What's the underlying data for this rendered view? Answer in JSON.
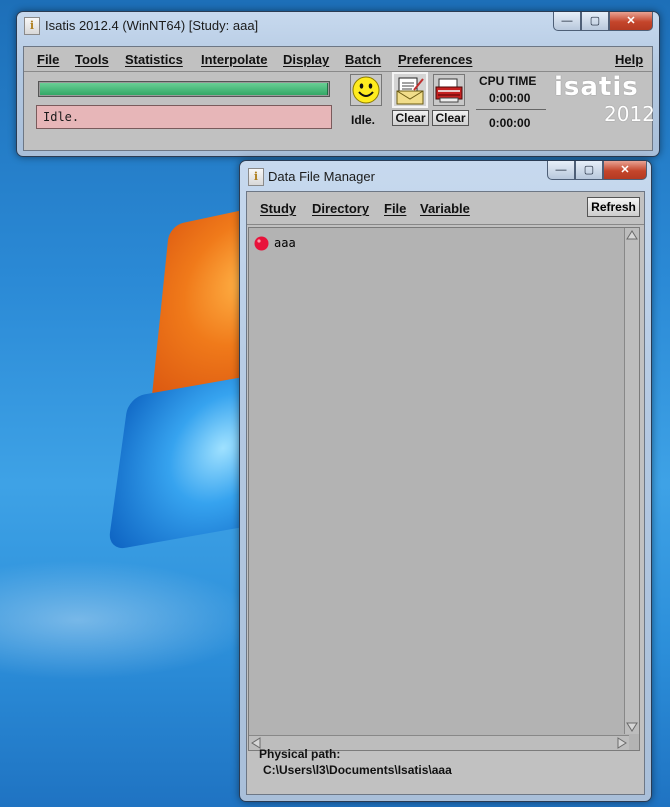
{
  "main_window": {
    "title": "Isatis 2012.4 (WinNT64) [Study: aaa]",
    "title_icon": "i",
    "caption": {
      "minimize": "—",
      "maximize": "▢",
      "close": "✕"
    },
    "menus": [
      "File",
      "Tools",
      "Statistics",
      "Interpolate",
      "Display",
      "Batch",
      "Preferences"
    ],
    "help_menu": "Help",
    "progress_fraction": 1.0,
    "status_text": "Idle.",
    "smiley_label": "Idle.",
    "clear_label_1": "Clear",
    "clear_label_2": "Clear",
    "cpu_title": "CPU TIME",
    "cpu_time_1": "0:00:00",
    "cpu_time_2": "0:00:00",
    "brand_name": "isatis",
    "brand_year": "2012"
  },
  "dfm_window": {
    "title": "Data File Manager",
    "title_icon": "i",
    "caption": {
      "minimize": "—",
      "maximize": "▢",
      "close": "✕"
    },
    "menus": [
      "Study",
      "Directory",
      "File",
      "Variable"
    ],
    "refresh_label": "Refresh",
    "items": [
      {
        "label": "aaa",
        "icon": "red-ball-icon"
      }
    ],
    "path_label": "Physical path:",
    "path_value": "C:\\Users\\l3\\Documents\\Isatis\\aaa"
  },
  "colors": {
    "progress": "#34a866",
    "status_bg": "#e7b6b8",
    "client_bg": "#c1c1c1"
  },
  "icons": [
    "smiley-icon",
    "mail-icon",
    "printer-icon",
    "red-ball-icon",
    "arrow-up-icon",
    "arrow-down-icon",
    "arrow-left-icon",
    "arrow-right-icon"
  ]
}
